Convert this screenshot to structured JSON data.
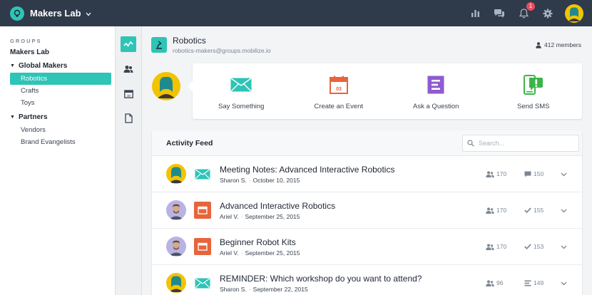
{
  "app": {
    "name": "Makers Lab",
    "notification_count": "1",
    "colors": {
      "topbar": "#2f3a4a",
      "accent": "#2ec4b6",
      "orange": "#e8643c",
      "purple": "#8e5bd0",
      "green": "#3bb54a"
    }
  },
  "sidebar": {
    "heading": "GROUPS",
    "root": "Makers Lab",
    "sections": [
      {
        "label": "Global Makers",
        "items": [
          "Robotics",
          "Crafts",
          "Toys"
        ]
      },
      {
        "label": "Partners",
        "items": [
          "Vendors",
          "Brand Evangelists"
        ]
      }
    ]
  },
  "group": {
    "title": "Robotics",
    "email": "robotics-makers@groups.mobilize.io",
    "members": "412 members"
  },
  "composer": {
    "actions": [
      {
        "label": "Say Something",
        "icon": "envelope-icon"
      },
      {
        "label": "Create an Event",
        "icon": "calendar-icon",
        "day": "03"
      },
      {
        "label": "Ask a Question",
        "icon": "question-form-icon"
      },
      {
        "label": "Send SMS",
        "icon": "phone-alert-icon"
      }
    ]
  },
  "feed": {
    "title": "Activity Feed",
    "search_placeholder": "Search...",
    "rows": [
      {
        "title": "Meeting Notes: Advanced Interactive Robotics",
        "author": "Sharon S.",
        "date": "October 10, 2015",
        "type": "message",
        "stat_a": "170",
        "stat_b": "150",
        "stat_b_icon": "comment-icon"
      },
      {
        "title": "Advanced Interactive Robotics",
        "author": "Ariel V.",
        "date": "September 25, 2015",
        "type": "event",
        "stat_a": "170",
        "stat_b": "155",
        "stat_b_icon": "check-icon"
      },
      {
        "title": "Beginner Robot Kits",
        "author": "Ariel V.",
        "date": "September 25, 2015",
        "type": "event",
        "stat_a": "170",
        "stat_b": "153",
        "stat_b_icon": "check-icon"
      },
      {
        "title": "REMINDER: Which workshop do you want to attend?",
        "author": "Sharon S.",
        "date": "September 22, 2015",
        "type": "message",
        "stat_a": "96",
        "stat_b": "149",
        "stat_b_icon": "list-icon"
      }
    ]
  }
}
